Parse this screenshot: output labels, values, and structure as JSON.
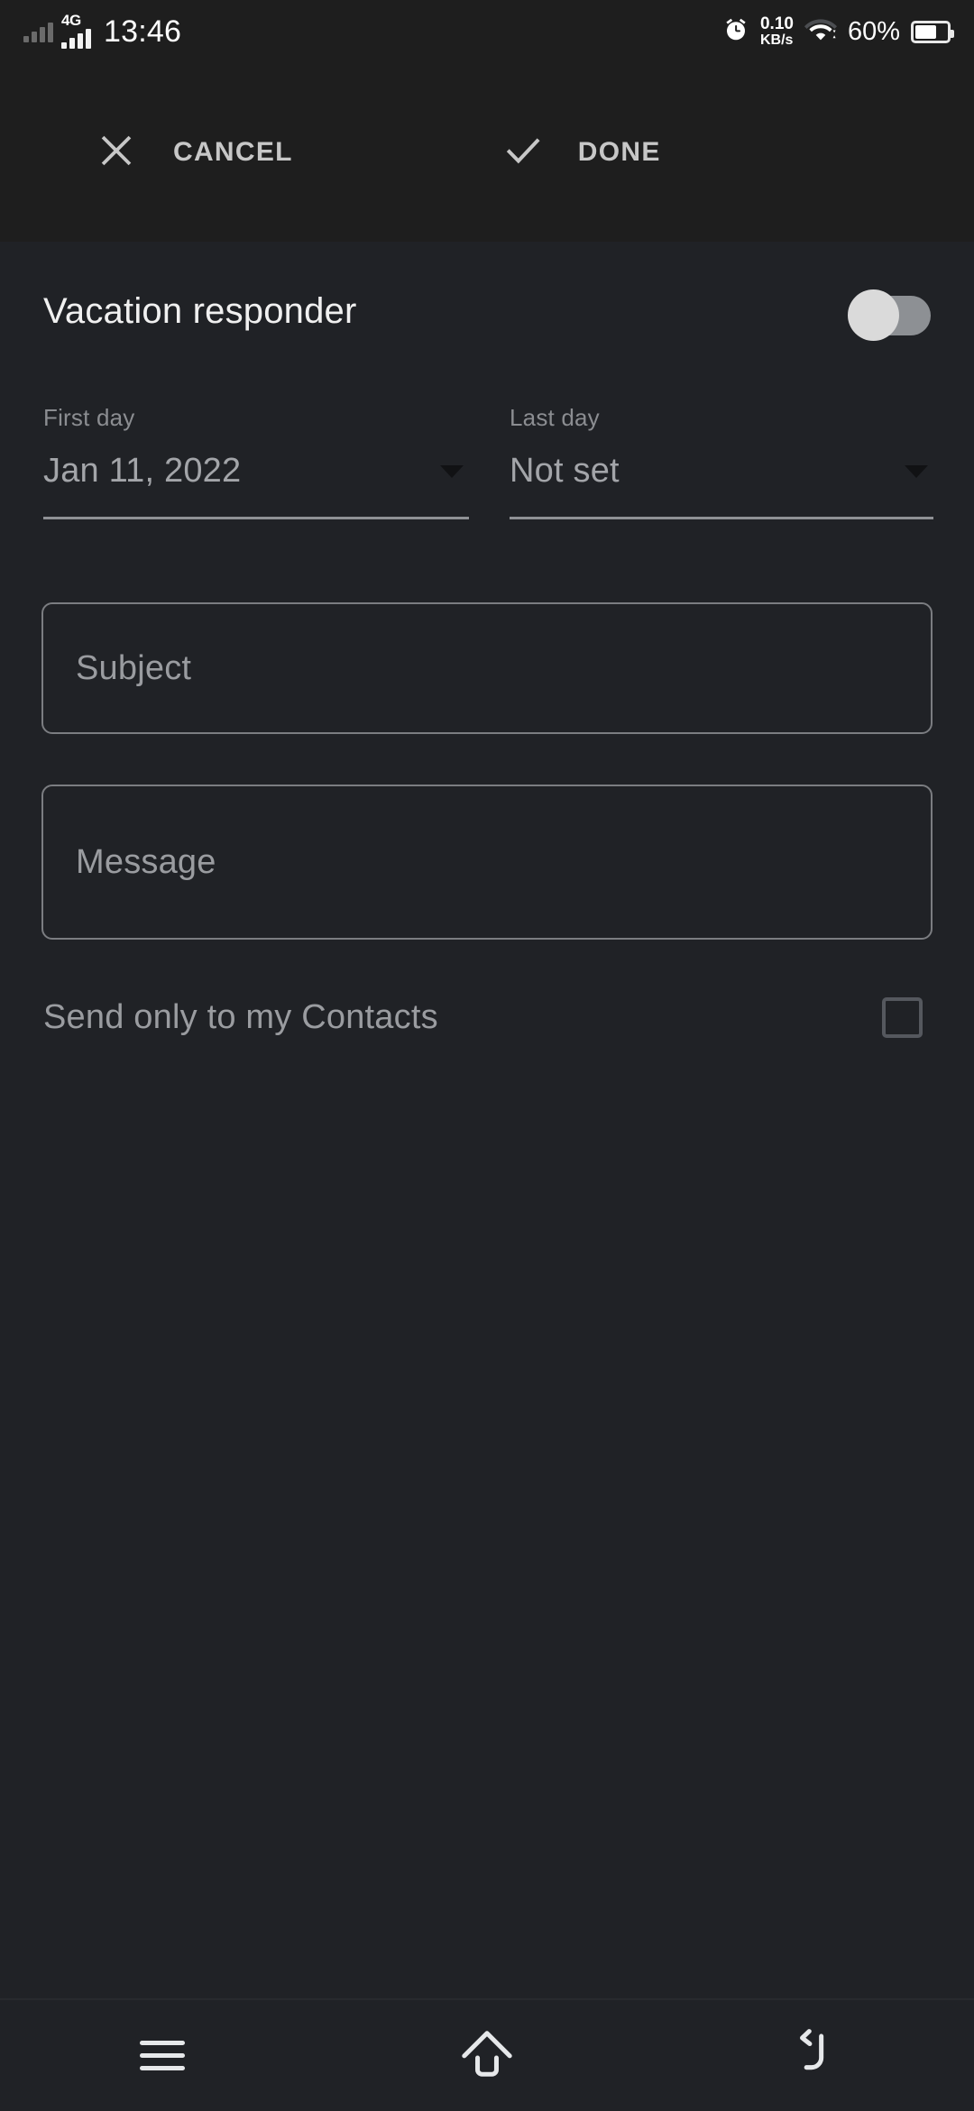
{
  "status_bar": {
    "sim1_icon": "signal-bars-dim-icon",
    "network_type": "4G",
    "sim2_icon": "signal-bars-icon",
    "time": "13:46",
    "alarm_icon": "alarm-clock-icon",
    "net_speed_value": "0.10",
    "net_speed_unit": "KB/s",
    "wifi_icon": "wifi-icon",
    "battery_percent": "60%",
    "battery_level": 60,
    "battery_icon": "battery-icon"
  },
  "app_bar": {
    "cancel_icon": "close-x-icon",
    "cancel_label": "CANCEL",
    "done_icon": "check-icon",
    "done_label": "DONE"
  },
  "main": {
    "responder_title": "Vacation responder",
    "responder_enabled": false,
    "first_day": {
      "label": "First day",
      "value": "Jan 11, 2022",
      "caret_icon": "dropdown-caret-icon"
    },
    "last_day": {
      "label": "Last day",
      "value": "Not set",
      "caret_icon": "dropdown-caret-icon"
    },
    "subject_placeholder": "Subject",
    "subject_value": "",
    "message_placeholder": "Message",
    "message_value": "",
    "contacts_label": "Send only to my Contacts",
    "contacts_checked": false
  },
  "nav_bar": {
    "recents_icon": "menu-recents-icon",
    "home_icon": "home-icon",
    "back_icon": "back-arrow-icon"
  },
  "colors": {
    "background": "#202226",
    "app_bar_background": "#1e1e1e",
    "primary_text": "#f0f0f0",
    "secondary_text": "#9a9ca0",
    "muted_text": "#8b8d91",
    "divider": "#8f9195",
    "switch_track": "#8d9094",
    "switch_thumb": "#dadada"
  }
}
